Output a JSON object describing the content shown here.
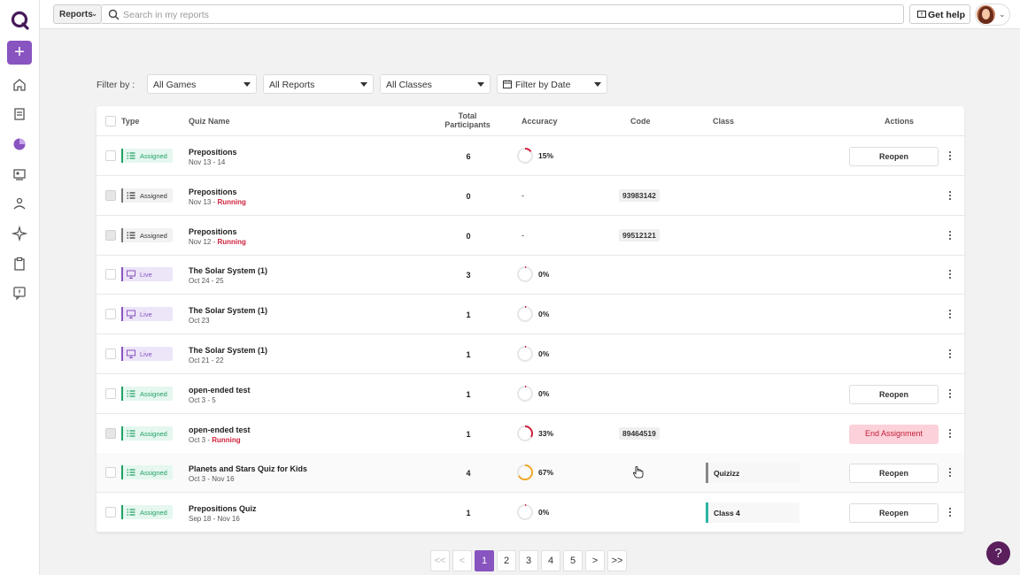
{
  "topbar": {
    "reports_label": "Reports",
    "search_placeholder": "Search in my reports",
    "help_label": "Get help"
  },
  "filters": {
    "label": "Filter by :",
    "games": "All Games",
    "reports": "All Reports",
    "classes": "All Classes",
    "date": "Filter by Date"
  },
  "table": {
    "headers": {
      "type": "Type",
      "quiz_name": "Quiz Name",
      "total_line1": "Total",
      "total_line2": "Participants",
      "accuracy": "Accuracy",
      "code": "Code",
      "class": "Class",
      "actions": "Actions"
    },
    "rows": [
      {
        "type": "Assigned",
        "name": "Prepositions",
        "date": "Nov 13 - 14",
        "status": "",
        "participants": "6",
        "accuracy": "15%",
        "code": "",
        "class": "",
        "action": "Reopen"
      },
      {
        "type": "Assigned",
        "name": "Prepositions",
        "date": "Nov 13 - ",
        "status": "Running",
        "participants": "0",
        "accuracy": "-",
        "code": "93983142",
        "class": "",
        "action": ""
      },
      {
        "type": "Assigned",
        "name": "Prepositions",
        "date": "Nov 12 - ",
        "status": "Running",
        "participants": "0",
        "accuracy": "-",
        "code": "99512121",
        "class": "",
        "action": ""
      },
      {
        "type": "Live",
        "name": "The Solar System (1)",
        "date": "Oct 24 - 25",
        "status": "",
        "participants": "3",
        "accuracy": "0%",
        "code": "",
        "class": "",
        "action": ""
      },
      {
        "type": "Live",
        "name": "The Solar System (1)",
        "date": "Oct 23",
        "status": "",
        "participants": "1",
        "accuracy": "0%",
        "code": "",
        "class": "",
        "action": ""
      },
      {
        "type": "Live",
        "name": "The Solar System (1)",
        "date": "Oct 21 - 22",
        "status": "",
        "participants": "1",
        "accuracy": "0%",
        "code": "",
        "class": "",
        "action": ""
      },
      {
        "type": "Assigned",
        "name": "open-ended test",
        "date": "Oct 3 - 5",
        "status": "",
        "participants": "1",
        "accuracy": "0%",
        "code": "",
        "class": "",
        "action": "Reopen"
      },
      {
        "type": "Assigned",
        "name": "open-ended test",
        "date": "Oct 3 - ",
        "status": "Running",
        "participants": "1",
        "accuracy": "33%",
        "code": "89464519",
        "class": "",
        "action": "End Assignment"
      },
      {
        "type": "Assigned",
        "name": "Planets and Stars Quiz for Kids",
        "date": "Oct 3 - Nov 16",
        "status": "",
        "participants": "4",
        "accuracy": "67%",
        "code": "",
        "class": "Quizizz",
        "action": "Reopen"
      },
      {
        "type": "Assigned",
        "name": "Prepositions Quiz",
        "date": "Sep 18 - Nov 16",
        "status": "",
        "participants": "1",
        "accuracy": "0%",
        "code": "",
        "class": "Class 4",
        "action": "Reopen"
      }
    ]
  },
  "pagination": {
    "first": "<<",
    "prev": "<",
    "pages": [
      "1",
      "2",
      "3",
      "4",
      "5"
    ],
    "next": ">",
    "last": ">>",
    "current": "1"
  },
  "help_fab": "?",
  "colors": {
    "brand": "#8854c0",
    "running": "#d0213c",
    "assigned": "#21a065"
  }
}
